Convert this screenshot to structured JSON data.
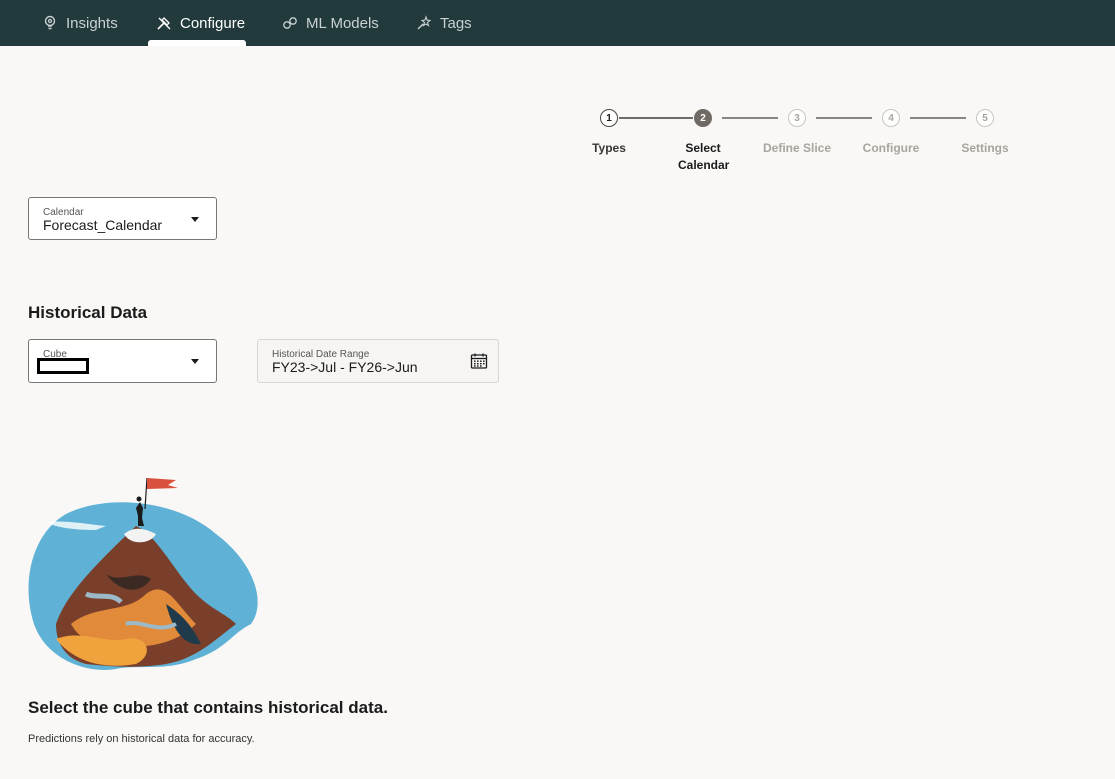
{
  "nav": {
    "tabs": [
      {
        "label": "Insights",
        "icon": "lightbulb-icon"
      },
      {
        "label": "Configure",
        "icon": "tools-icon",
        "active": true
      },
      {
        "label": "ML Models",
        "icon": "ml-models-icon"
      },
      {
        "label": "Tags",
        "icon": "tags-icon"
      }
    ]
  },
  "stepper": {
    "steps": [
      {
        "number": "1",
        "label": "Types",
        "state": "completed"
      },
      {
        "number": "2",
        "label": "Select Calendar",
        "state": "current"
      },
      {
        "number": "3",
        "label": "Define Slice",
        "state": "upcoming"
      },
      {
        "number": "4",
        "label": "Configure",
        "state": "upcoming"
      },
      {
        "number": "5",
        "label": "Settings",
        "state": "upcoming"
      }
    ]
  },
  "calendar": {
    "label": "Calendar",
    "value": "Forecast_Calendar"
  },
  "historical": {
    "heading": "Historical Data",
    "cube": {
      "label": "Cube",
      "value": ""
    },
    "date_range": {
      "label": "Historical Date Range",
      "value": "FY23->Jul - FY26->Jun"
    }
  },
  "empty_state": {
    "headline": "Select the cube that contains historical data.",
    "description": "Predictions rely on historical data for accuracy."
  },
  "colors": {
    "nav_bg": "#223a3b",
    "page_bg": "#f9f8f6",
    "step_current": "#6f6a64",
    "step_upcoming": "#c9c5c0"
  }
}
